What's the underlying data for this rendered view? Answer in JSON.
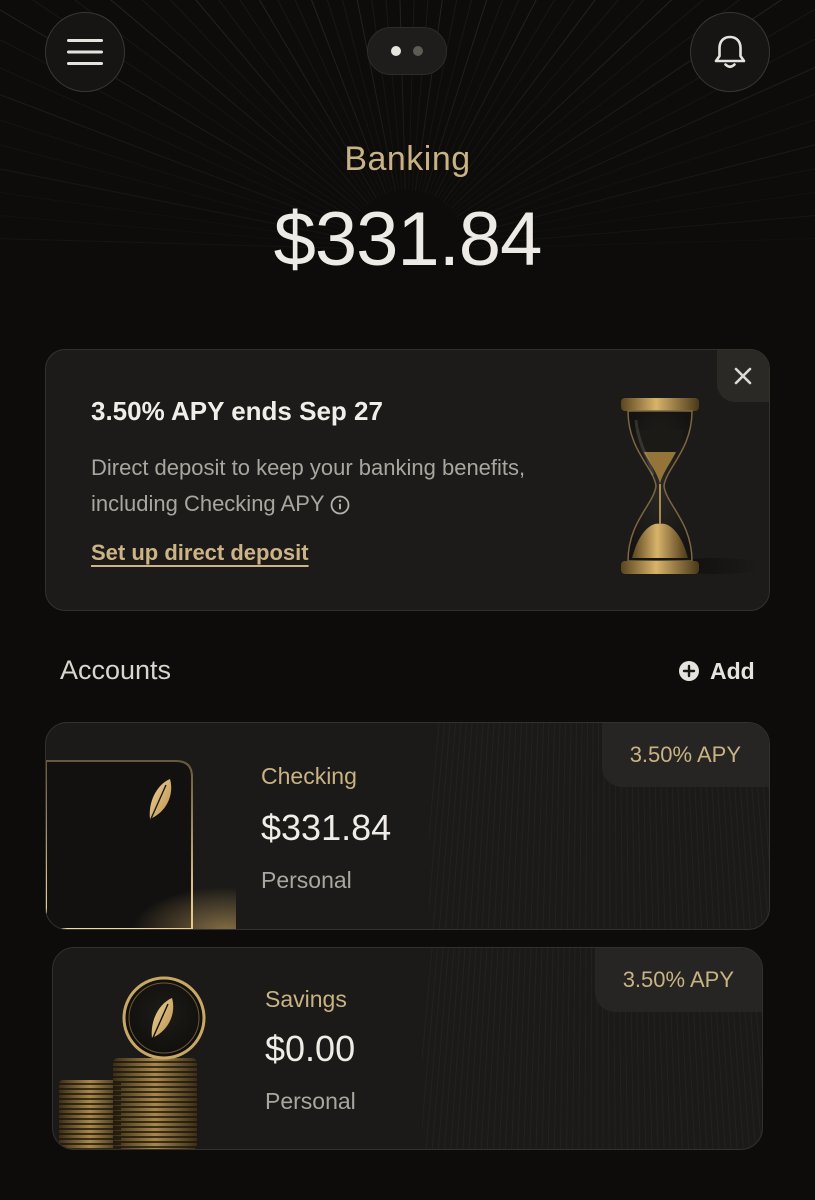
{
  "header": {
    "menu_icon": "menu-icon",
    "bell_icon": "bell-icon",
    "pager": {
      "pages": 2,
      "active": 1
    },
    "title": "Banking",
    "balance": "$331.84"
  },
  "promo": {
    "title": "3.50% APY ends Sep 27",
    "body": "Direct deposit to keep your banking benefits, including Checking APY",
    "link": "Set up direct deposit",
    "close_icon": "close-icon",
    "info_icon": "info-icon",
    "image_icon": "hourglass-icon"
  },
  "accounts": {
    "title": "Accounts",
    "add_label": "Add",
    "add_icon": "plus-circle-icon",
    "items": [
      {
        "name": "Checking",
        "amount": "$331.84",
        "type": "Personal",
        "apy": "3.50% APY",
        "art_icon": "card-icon"
      },
      {
        "name": "Savings",
        "amount": "$0.00",
        "type": "Personal",
        "apy": "3.50% APY",
        "art_icon": "coin-stack-icon"
      }
    ]
  },
  "colors": {
    "background": "#0d0c0b",
    "accent_gold": "#c9b283",
    "card_bg": "#1b1a18"
  }
}
